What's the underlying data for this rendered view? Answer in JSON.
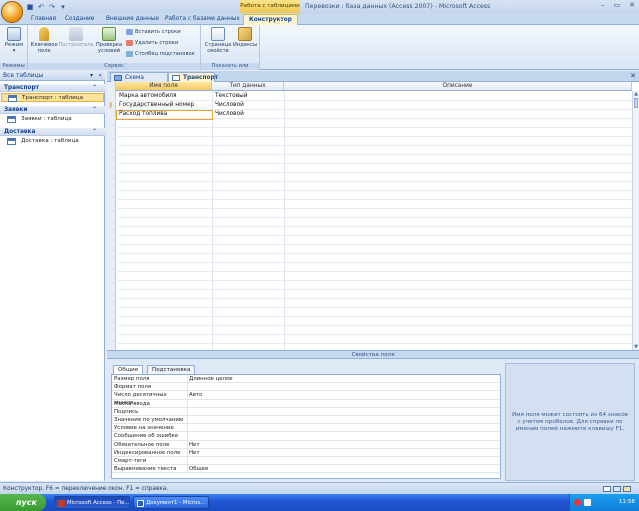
{
  "window": {
    "title": "Перевозки : база данных (Access 2007) - Microsoft Access",
    "context_tab": "Работа с таблицами",
    "controls": [
      "–",
      "▭",
      "✕"
    ]
  },
  "ribbon_tabs": [
    "Главная",
    "Создание",
    "Внешние данные",
    "Работа с базами данных",
    "Конструктор"
  ],
  "ribbon": {
    "groups": {
      "modes": "Режимы",
      "service": "Сервис",
      "showhide": "Показать или скрыть"
    },
    "buttons": {
      "mode": "Режим",
      "key_field": "Ключевое поле",
      "builder": "Построитель",
      "check": "Проверка условий",
      "insert_rows": "Вставить строки",
      "delete_rows": "Удалить строки",
      "lookup_column": "Столбец подстановок",
      "property_sheet": "Страница свойств",
      "indexes": "Индексы"
    }
  },
  "nav": {
    "header": "Все таблицы",
    "groups": [
      {
        "name": "Транспорт",
        "item": "Транспорт : таблица"
      },
      {
        "name": "Заявки",
        "item": "Заявки : таблица"
      },
      {
        "name": "Доставка",
        "item": "Доставка : таблица"
      }
    ]
  },
  "doc_tabs": [
    "Схема данных",
    "Транспорт"
  ],
  "grid": {
    "headers": [
      "Имя поля",
      "Тип данных",
      "Описание"
    ],
    "rows": [
      {
        "name": "Марка автомобиля",
        "type": "Текстовый",
        "desc": ""
      },
      {
        "name": "Государственный номер",
        "type": "Числовой",
        "desc": ""
      },
      {
        "name": "Расход топлива",
        "type": "Числовой",
        "desc": ""
      }
    ]
  },
  "properties": {
    "bar_title": "Свойства поля",
    "tabs": [
      "Общие",
      "Подстановка"
    ],
    "rows": [
      {
        "name": "Размер поля",
        "value": "Длинное целое"
      },
      {
        "name": "Формат поля",
        "value": ""
      },
      {
        "name": "Число десятичных знаков",
        "value": "Авто"
      },
      {
        "name": "Маска ввода",
        "value": ""
      },
      {
        "name": "Подпись",
        "value": ""
      },
      {
        "name": "Значение по умолчанию",
        "value": ""
      },
      {
        "name": "Условие на значение",
        "value": ""
      },
      {
        "name": "Сообщение об ошибке",
        "value": ""
      },
      {
        "name": "Обязательное поле",
        "value": "Нет"
      },
      {
        "name": "Индексированное поле",
        "value": "Нет"
      },
      {
        "name": "Смарт-теги",
        "value": ""
      },
      {
        "name": "Выравнивание текста",
        "value": "Общее"
      }
    ],
    "hint": "Имя поля может состоять из 64 знаков с учетом пробелов. Для справки по именам полей нажмите клавишу F1."
  },
  "status": {
    "text": "Конструктор. F6 = переключение окон. F1 = справка."
  },
  "taskbar": {
    "start": "пуск",
    "tasks": [
      "Microsoft Access - Пе...",
      "Документ1 - Micros..."
    ],
    "lang": "RU",
    "clock": "11:58"
  }
}
